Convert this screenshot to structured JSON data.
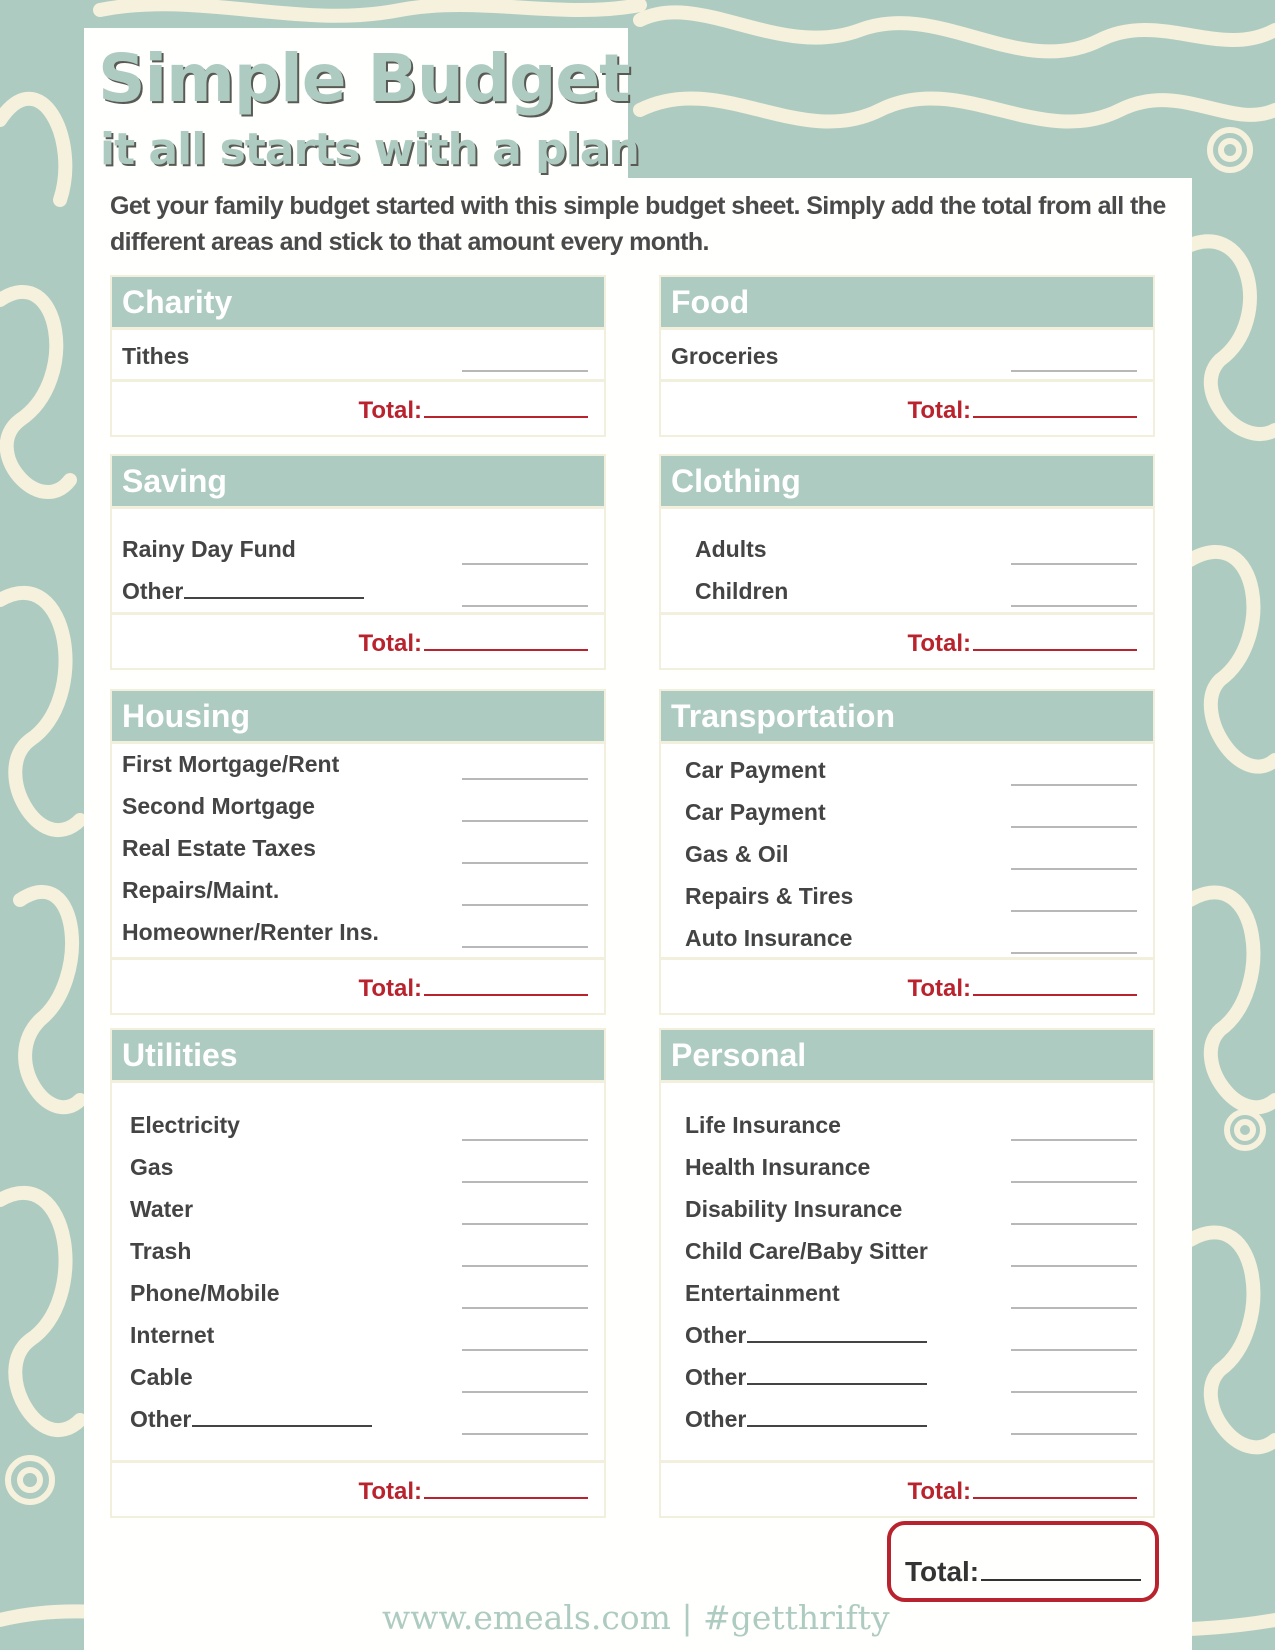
{
  "header": {
    "title": "Simple Budget",
    "subtitle": "it all starts with a plan",
    "intro": "Get your family budget started with this simple budget sheet. Simply add the total from all the different areas and stick to that amount every month."
  },
  "total_label": "Total:",
  "sections": [
    {
      "name": "Charity",
      "items": [
        {
          "label": "Tithes"
        }
      ]
    },
    {
      "name": "Food",
      "items": [
        {
          "label": "Groceries"
        }
      ]
    },
    {
      "name": "Saving",
      "items": [
        {
          "label": "Rainy Day Fund"
        },
        {
          "label": "Other",
          "fill": true
        }
      ]
    },
    {
      "name": "Clothing",
      "items": [
        {
          "label": "Adults"
        },
        {
          "label": "Children"
        }
      ]
    },
    {
      "name": "Housing",
      "items": [
        {
          "label": "First Mortgage/Rent"
        },
        {
          "label": "Second Mortgage"
        },
        {
          "label": "Real Estate Taxes"
        },
        {
          "label": "Repairs/Maint."
        },
        {
          "label": "Homeowner/Renter Ins."
        }
      ]
    },
    {
      "name": "Transportation",
      "items": [
        {
          "label": "Car Payment"
        },
        {
          "label": "Car Payment"
        },
        {
          "label": "Gas & Oil"
        },
        {
          "label": "Repairs & Tires"
        },
        {
          "label": "Auto Insurance"
        }
      ]
    },
    {
      "name": "Utilities",
      "items": [
        {
          "label": "Electricity"
        },
        {
          "label": "Gas"
        },
        {
          "label": "Water"
        },
        {
          "label": "Trash"
        },
        {
          "label": "Phone/Mobile"
        },
        {
          "label": "Internet"
        },
        {
          "label": "Cable"
        },
        {
          "label": "Other",
          "fill": true
        }
      ]
    },
    {
      "name": "Personal",
      "items": [
        {
          "label": "Life Insurance"
        },
        {
          "label": "Health Insurance"
        },
        {
          "label": "Disability Insurance"
        },
        {
          "label": "Child Care/Baby Sitter"
        },
        {
          "label": "Entertainment"
        },
        {
          "label": "Other",
          "fill": true
        },
        {
          "label": "Other",
          "fill": true
        },
        {
          "label": "Other",
          "fill": true
        }
      ]
    }
  ],
  "grand_total_label": "Total:",
  "footer": "www.emeals.com | #getthrifty",
  "colors": {
    "accent": "#aecbc1",
    "total_red": "#b8232e",
    "text": "#444444",
    "background_cream": "#f3efdd"
  }
}
